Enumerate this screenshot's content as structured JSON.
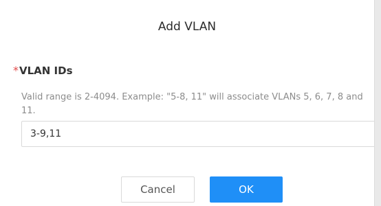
{
  "dialog": {
    "title": "Add VLAN",
    "field": {
      "required_mark": "*",
      "label": "VLAN IDs",
      "help_text": "Valid range is 2-4094. Example: \"5-8, 11\" will associate VLANs 5, 6, 7, 8 and 11.",
      "value": "3-9,11"
    },
    "buttons": {
      "cancel": "Cancel",
      "ok": "OK"
    }
  },
  "colors": {
    "primary": "#1f8ff7",
    "required": "#e14b4b"
  }
}
